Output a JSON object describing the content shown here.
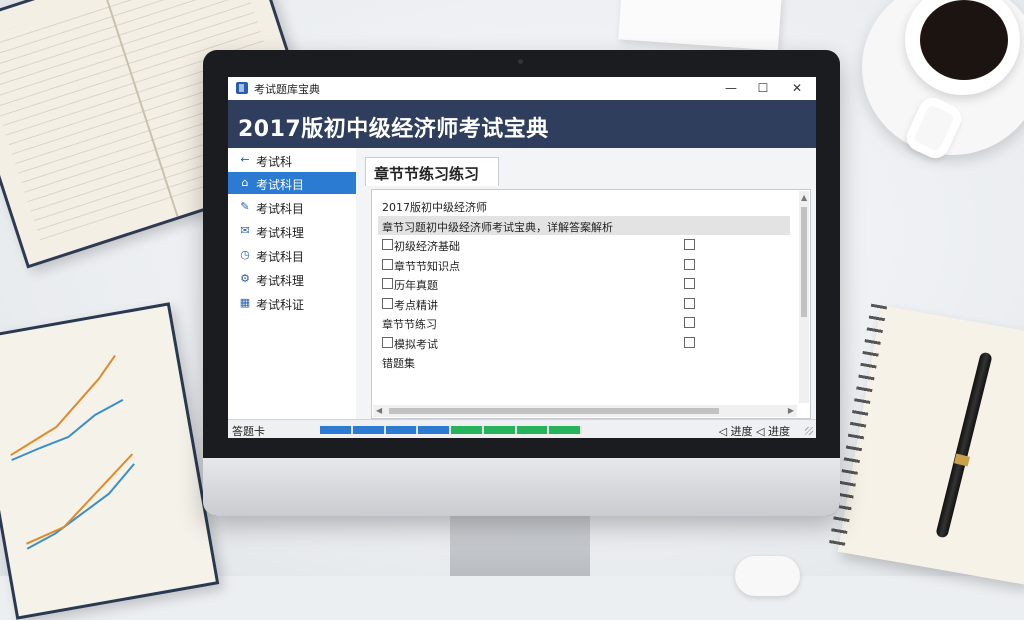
{
  "window": {
    "title": "考试题库宝典",
    "banner": "2017版初中级经济师考试宝典",
    "controls": {
      "minimize": "—",
      "maximize": "☐",
      "close": "✕"
    }
  },
  "sidebar": {
    "items": [
      {
        "label": "考试科",
        "icon": "back-arrow-icon",
        "glyph": "←"
      },
      {
        "label": "考试科目",
        "icon": "home-icon",
        "glyph": "⌂",
        "active": true
      },
      {
        "label": "考试科目",
        "icon": "edit-icon",
        "glyph": "✎"
      },
      {
        "label": "考试科理",
        "icon": "mail-icon",
        "glyph": "✉"
      },
      {
        "label": "考试科目",
        "icon": "clock-icon",
        "glyph": "◷"
      },
      {
        "label": "考试科理",
        "icon": "settings-icon",
        "glyph": "⚙"
      },
      {
        "label": "考试科证",
        "icon": "calendar-icon",
        "glyph": "▦"
      }
    ]
  },
  "main": {
    "tab_label": "章节节练习练习",
    "rows": [
      {
        "text": "2017版初中级经济师",
        "checkbox": false,
        "right_checkbox": false,
        "highlight": false
      },
      {
        "text": "章节习题初中级经济师考试宝典，详解答案解析",
        "checkbox": false,
        "right_checkbox": false,
        "highlight": true
      },
      {
        "text": "初级经济基础",
        "checkbox": true,
        "right_checkbox": true,
        "highlight": false
      },
      {
        "text": "章节节知识点",
        "checkbox": true,
        "right_checkbox": true,
        "highlight": false
      },
      {
        "text": "历年真题",
        "checkbox": true,
        "right_checkbox": true,
        "highlight": false
      },
      {
        "text": "考点精讲",
        "checkbox": true,
        "right_checkbox": true,
        "highlight": false
      },
      {
        "text": "章节节练习",
        "checkbox": false,
        "right_checkbox": true,
        "highlight": false
      },
      {
        "text": "模拟考试",
        "checkbox": true,
        "right_checkbox": true,
        "highlight": false
      },
      {
        "text": "错题集",
        "checkbox": false,
        "right_checkbox": false,
        "highlight": false
      }
    ]
  },
  "status": {
    "left": "答题卡",
    "right": "◁ 进度 ◁ 进度",
    "progress": {
      "value": 1.0,
      "colors": [
        "#2a7bd1",
        "#2a7bd1",
        "#2a7bd1",
        "#2a7bd1",
        "#27b35a",
        "#27b35a",
        "#27b35a",
        "#27b35a"
      ]
    }
  }
}
